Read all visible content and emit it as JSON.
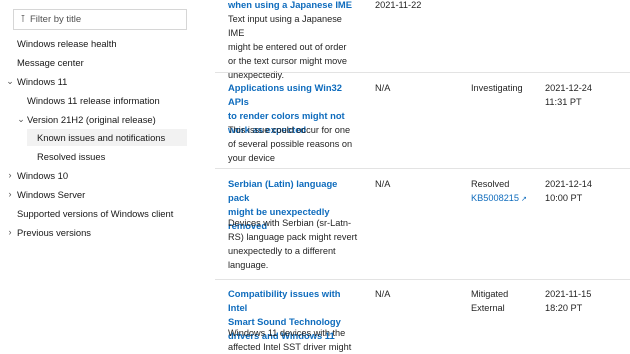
{
  "sidebar": {
    "filter_placeholder": "Filter by title",
    "filter_icon": "filter-icon",
    "items": [
      {
        "label": "Windows release health"
      },
      {
        "label": "Message center"
      },
      {
        "label": "Windows 11",
        "expanded": true
      },
      {
        "label": "Windows 11 release information"
      },
      {
        "label": "Version 21H2 (original release)",
        "expanded": true
      },
      {
        "label": "Known issues and notifications",
        "selected": true
      },
      {
        "label": "Resolved issues"
      },
      {
        "label": "Windows 10",
        "expanded": false
      },
      {
        "label": "Windows Server",
        "expanded": false
      },
      {
        "label": "Supported versions of Windows client"
      },
      {
        "label": "Previous versions",
        "expanded": false
      }
    ]
  },
  "issues": [
    {
      "title_lines": [
        "when using a Japanese IME"
      ],
      "description_lines": [
        "Text input using a Japanese IME",
        "might be entered out of order",
        "or the text cursor might move",
        "unexpectedly."
      ],
      "date": "2021-11-22"
    },
    {
      "title_lines": [
        "Applications using Win32 APIs",
        "to render colors might not",
        "work as expected"
      ],
      "description_lines": [
        "This issue could occur for one",
        "of several possible reasons on",
        "your device"
      ],
      "originating_update": "N/A",
      "status": "Investigating",
      "date_line1": "2021-12-24",
      "date_line2": "11:31 PT"
    },
    {
      "title_lines": [
        "Serbian (Latin) language pack",
        "might be unexpectedly",
        "removed"
      ],
      "description_lines": [
        "Devices with Serbian (sr-Latn-",
        "RS) language pack might revert",
        "unexpectedly to a different",
        "language."
      ],
      "originating_update": "N/A",
      "status": "Resolved",
      "status_link": "KB5008215",
      "date_line1": "2021-12-14",
      "date_line2": "10:00 PT"
    },
    {
      "title_lines": [
        "Compatibility issues with Intel",
        "Smart Sound Technology",
        "drivers and Windows 11"
      ],
      "description_lines": [
        "Windows 11 devices with the",
        "affected Intel SST driver might"
      ],
      "originating_update": "N/A",
      "status_line1": "Mitigated",
      "status_line2": "External",
      "date_line1": "2021-11-15",
      "date_line2": "18:20 PT"
    }
  ],
  "colors": {
    "link": "#0f6cbd",
    "text": "#171717",
    "selected_bg": "#f2f2f2",
    "separator": "#e3e3e3"
  }
}
